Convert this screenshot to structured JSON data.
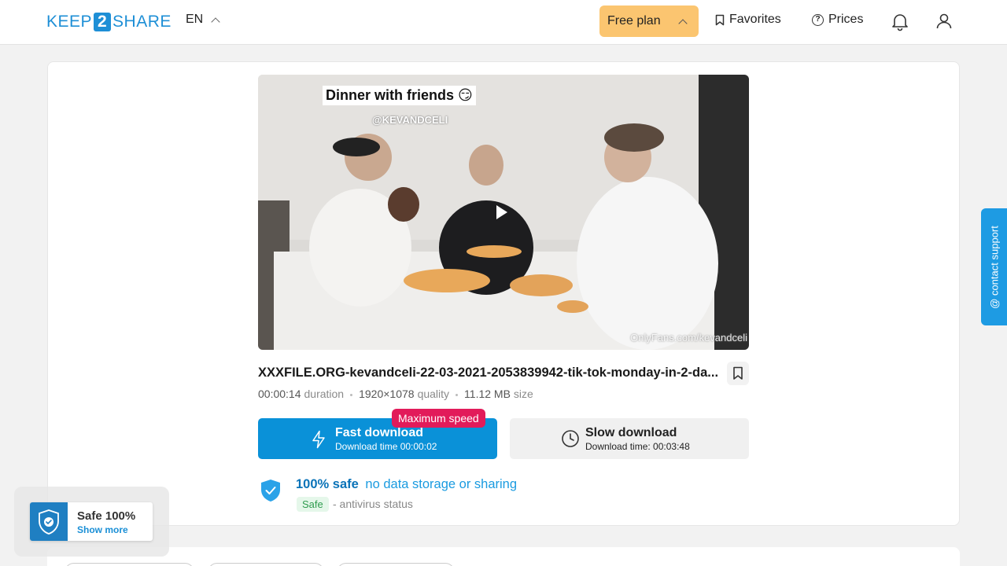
{
  "header": {
    "logo_left": "KEEP",
    "logo_num": "2",
    "logo_right": "SHARE",
    "language": "EN",
    "plan_label": "Free plan",
    "favorites_label": "Favorites",
    "prices_label": "Prices"
  },
  "video": {
    "caption": "Dinner with friends 😏",
    "handle": "@KEVANDCELI",
    "watermark": "OnlyFans.com/kevandceli"
  },
  "file": {
    "name": "XXXFILE.ORG-kevandceli-22-03-2021-2053839942-tik-tok-monday-in-2-da...",
    "duration": "00:00:14",
    "duration_label": "duration",
    "quality": "1920×1078",
    "quality_label": "quality",
    "size": "11.12 MB",
    "size_label": "size"
  },
  "download": {
    "fast_title": "Fast download",
    "fast_time": "Download time 00:00:02",
    "badge": "Maximum speed",
    "slow_title": "Slow download",
    "slow_time": "Download time: 00:03:48"
  },
  "safety": {
    "headline": "100% safe",
    "headline_link": "no data storage or sharing",
    "badge": "Safe",
    "status": "- antivirus status"
  },
  "support": {
    "label": "@ contact support"
  },
  "safe_widget": {
    "title": "Safe 100%",
    "more": "Show more"
  },
  "colors": {
    "brand": "#1e8fd6",
    "plan": "#fbc570",
    "fast": "#0a91d8",
    "badge": "#e21b5a"
  }
}
